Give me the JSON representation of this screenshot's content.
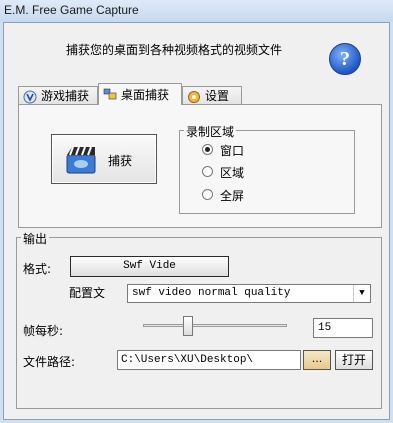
{
  "window": {
    "title": "E.M. Free Game Capture"
  },
  "header": {
    "description": "捕获您的桌面到各种视频格式的视频文件"
  },
  "tabs": [
    {
      "label": "游戏捕获",
      "icon": "game-icon"
    },
    {
      "label": "桌面捕获",
      "icon": "desktop-icon"
    },
    {
      "label": "设置",
      "icon": "settings-gear-icon"
    }
  ],
  "capture": {
    "button_label": "捕获",
    "icon": "clapperboard-icon"
  },
  "record_area": {
    "legend": "录制区域",
    "options": [
      "窗口",
      "区域",
      "全屏"
    ],
    "selected": "窗口"
  },
  "output": {
    "legend": "输出",
    "format_label": "格式:",
    "format_value": "Swf Vide",
    "profile_label": "配置文",
    "profile_value": "swf video normal quality",
    "fps_label": "帧每秒:",
    "fps_value": "15",
    "fps_slider_fraction": 0.3,
    "path_label": "文件路径:",
    "path_value": "C:\\Users\\XU\\Desktop\\",
    "browse_label": "...",
    "open_label": "打开"
  },
  "colors": {
    "accent": "#1f56c4",
    "browse": "#e7c98a"
  }
}
